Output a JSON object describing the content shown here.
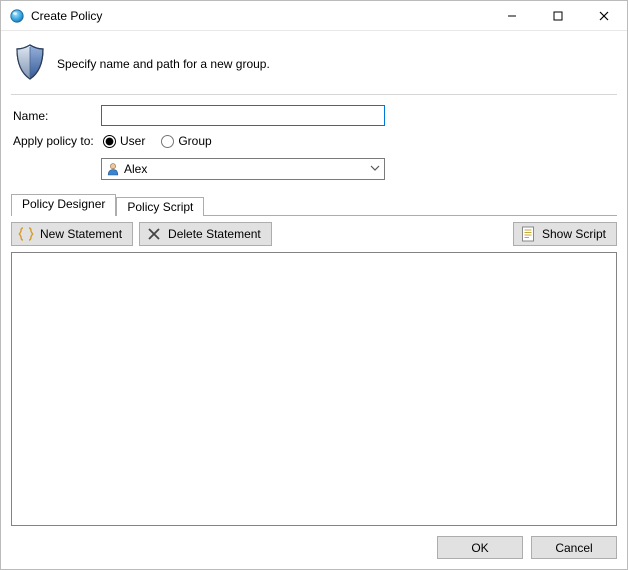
{
  "titlebar": {
    "title": "Create Policy"
  },
  "header": {
    "description": "Specify name and path for a new group."
  },
  "form": {
    "name_label": "Name:",
    "name_value": "",
    "apply_label": "Apply policy to:",
    "radio_user": "User",
    "radio_group": "Group",
    "radio_selected": "user",
    "selected_target": "Alex"
  },
  "tabs": {
    "designer": "Policy Designer",
    "script": "Policy Script"
  },
  "toolbar": {
    "new_statement": "New Statement",
    "delete_statement": "Delete Statement",
    "show_script": "Show Script"
  },
  "buttons": {
    "ok": "OK",
    "cancel": "Cancel"
  }
}
